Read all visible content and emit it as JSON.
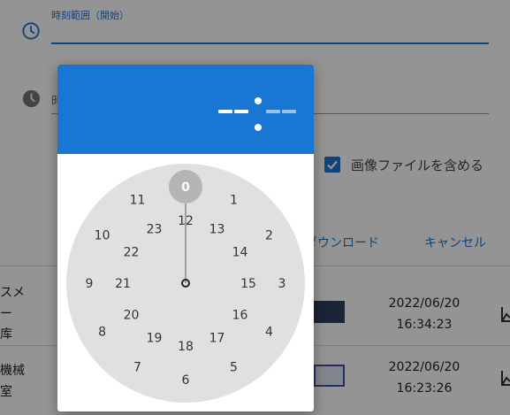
{
  "form": {
    "start_time_label": "時刻範囲（開始）",
    "end_time_label_partial": "時",
    "include_images_label": "画像ファイルを含める",
    "include_images_checked": true,
    "download_label": "ダウンロード",
    "cancel_label": "キャンセル"
  },
  "table": {
    "rows": [
      {
        "name_line1": "スメ",
        "name_line2": "ー",
        "name_line3": "库",
        "date": "2022/06/20",
        "time": "16:34:23"
      },
      {
        "name_line1": "機械",
        "name_line2": "室",
        "date": "2022/06/20",
        "time": "16:23:26"
      }
    ]
  },
  "time_picker": {
    "hour_display": "--",
    "minute_display": "--",
    "selected_hour": "0",
    "outer_hours": [
      "0",
      "1",
      "2",
      "3",
      "4",
      "5",
      "6",
      "7",
      "8",
      "9",
      "10",
      "11"
    ],
    "inner_hours": [
      "12",
      "13",
      "14",
      "15",
      "16",
      "17",
      "18",
      "19",
      "20",
      "21",
      "22",
      "23"
    ],
    "header_color": "#1976d2",
    "accent_color": "#1976d2"
  }
}
